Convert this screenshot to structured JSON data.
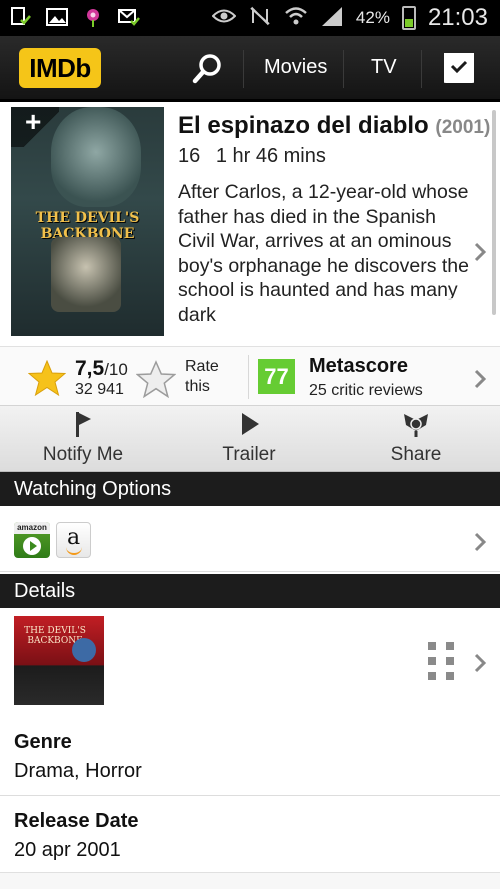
{
  "status_bar": {
    "battery_percent": "42%",
    "time": "21:03"
  },
  "app_bar": {
    "logo": "IMDb",
    "nav_movies": "Movies",
    "nav_tv": "TV"
  },
  "movie": {
    "title": "El espinazo del diablo",
    "year": "(2001)",
    "certificate": "16",
    "runtime": "1 hr 46 mins",
    "plot": "After Carlos, a 12-year-old whose father has died in the Spanish Civil War, arrives at an ominous boy's orphanage he discovers the school is haunted and has many dark",
    "poster_title": "THE DEVIL'S BACKBONE"
  },
  "ratings": {
    "rating": "7,5",
    "rating_max": "/10",
    "votes": "32 941",
    "rate_label_1": "Rate",
    "rate_label_2": "this",
    "metascore": "77",
    "metascore_label": "Metascore",
    "critic_reviews": "25 critic reviews"
  },
  "actions": {
    "notify": "Notify Me",
    "trailer": "Trailer",
    "share": "Share"
  },
  "sections": {
    "watching_options": "Watching Options",
    "details": "Details"
  },
  "watch_options": {
    "amazon_video_badge": "amazon"
  },
  "details": {
    "poster_title": "THE DEVIL'S BACKBONE",
    "genre_label": "Genre",
    "genre_value": "Drama, Horror",
    "release_label": "Release Date",
    "release_value": "20 apr 2001"
  },
  "colors": {
    "imdb_yellow": "#f5c518",
    "metascore_green": "#66cc33",
    "header_dark": "#1c1c1c"
  }
}
